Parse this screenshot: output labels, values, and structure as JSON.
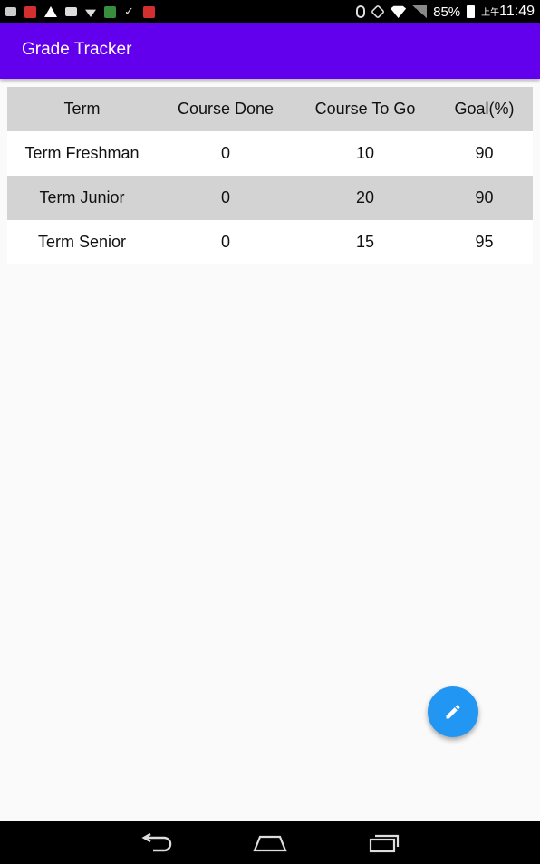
{
  "status_bar": {
    "battery_percent": "85%",
    "time_prefix": "上午",
    "time": "11:49"
  },
  "app_bar": {
    "title": "Grade Tracker"
  },
  "table": {
    "headers": [
      "Term",
      "Course Done",
      "Course To Go",
      "Goal(%)"
    ],
    "rows": [
      [
        "Term Freshman",
        "0",
        "10",
        "90"
      ],
      [
        "Term Junior",
        "0",
        "20",
        "90"
      ],
      [
        "Term Senior",
        "0",
        "15",
        "95"
      ]
    ]
  },
  "fab": {
    "icon": "pencil-icon",
    "color": "#2196f3"
  },
  "colors": {
    "app_bar": "#6200ee",
    "header_row": "#d3d3d3",
    "accent": "#2196f3"
  },
  "nav_bar": {
    "icons": [
      "back-icon",
      "home-icon",
      "recents-icon"
    ]
  }
}
